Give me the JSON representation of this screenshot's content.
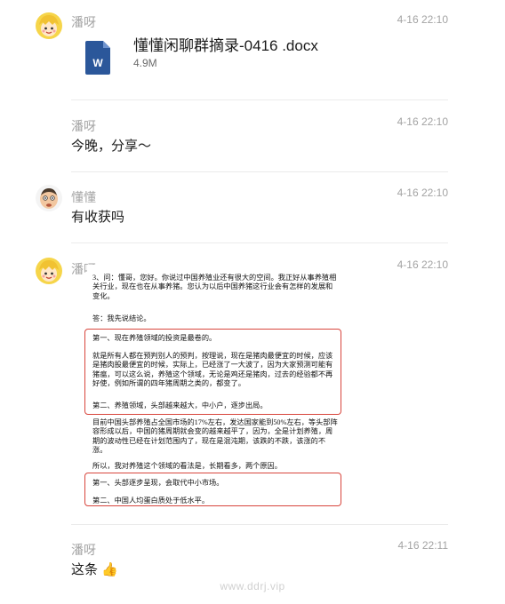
{
  "messages": [
    {
      "sender": "潘呀",
      "time": "4-16 22:10",
      "file": {
        "name": "懂懂闲聊群摘录-0416 .docx",
        "size": "4.9M",
        "icon_letter": "W",
        "icon_color": "#2b579a"
      }
    },
    {
      "sender": "潘呀",
      "time": "4-16 22:10",
      "text": "今晚，分享～"
    },
    {
      "sender": "懂懂",
      "time": "4-16 22:10",
      "text": "有收获吗"
    },
    {
      "sender": "潘呀",
      "time": "4-16 22:10",
      "image_text": {
        "p1": "3、问：懂哥，您好。你说过中国养殖业还有很大的空间。我正好从事养殖相关行业，现在也在从事养猪。您认为以后中国养猪这行业会有怎样的发展和变化。",
        "p2": "答：我先说结论。",
        "p3": "第一、现在养殖领域的投资是最卷的。",
        "p4": "就是所有人都在预判别人的预判，按理说，现在是猪肉最便宜的时候，应该是猪肉股最便宜的时候，实际上，已经涨了一大波了，因为大家预测可能有猪瘟，可以这么说，养殖这个领域，无论是鸡还是猪肉，过去的经验都不再好使，例如所谓的四年猪周期之类的，都变了。",
        "p5": "第二、养殖领域，头部越来越大，中小户，逐步出局。",
        "p6": "目前中国头部养殖占全国市场的17%左右，发达国家能到50%左右，等头部阵容形成以后，中国的猪周期就会变的越来越平了，因为，全是计划养殖，周期的波动性已经在计划范围内了，现在是混沌期，该跌的不跌，该涨的不涨。",
        "p7": "所以，我对养殖这个领域的看法是，长期看多，两个原因。",
        "p8": "第一、头部逐步呈现，会取代中小市场。",
        "p9": "第二、中国人均蛋白质处于低水平。"
      }
    },
    {
      "sender": "潘呀",
      "time": "4-16 22:11",
      "text": "这条",
      "emoji": "👍"
    }
  ],
  "watermark": "www.ddrj.vip",
  "colors": {
    "highlight_box": "#d8453c",
    "meta_text": "#a3a3a3",
    "divider": "#ebebeb"
  }
}
